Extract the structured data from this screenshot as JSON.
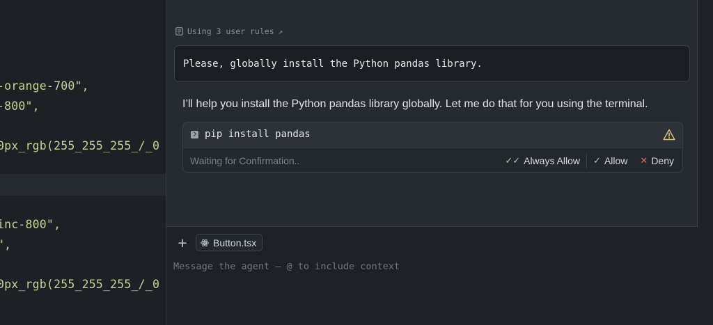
{
  "editor": {
    "lines": [
      {
        "text": "-orange-700\","
      },
      {
        "text": "-800\","
      },
      {
        "text": "0px_rgb(255_255_255_/_0"
      },
      {
        "text": "inc-800\","
      },
      {
        "text": "\","
      },
      {
        "text": "0px_rgb(255_255_255_/_0"
      }
    ]
  },
  "agent": {
    "rules_label": "Using 3 user rules",
    "rules_icon": "document-icon",
    "rules_link_icon": "arrow-up-right-icon",
    "user_message": "Please, globally install the Python pandas library.",
    "assistant_message": "I’ll help you install the Python pandas library globally. Let me do that for you using the terminal.",
    "tool_call": {
      "command": "pip install pandas",
      "icon": "terminal-icon",
      "status_icon": "warning-icon",
      "status_text": "Waiting for Confirmation..",
      "actions": {
        "always_allow": "Always Allow",
        "allow": "Allow",
        "deny": "Deny"
      }
    }
  },
  "composer": {
    "add_label": "+",
    "context_chip": "Button.tsx",
    "placeholder": "Message the agent — @ to include context"
  },
  "colors": {
    "accent_green": "#a7d39b",
    "deny_red": "#e06a6a",
    "warning": "#d9c27a",
    "code_string": "#c8d39a"
  }
}
